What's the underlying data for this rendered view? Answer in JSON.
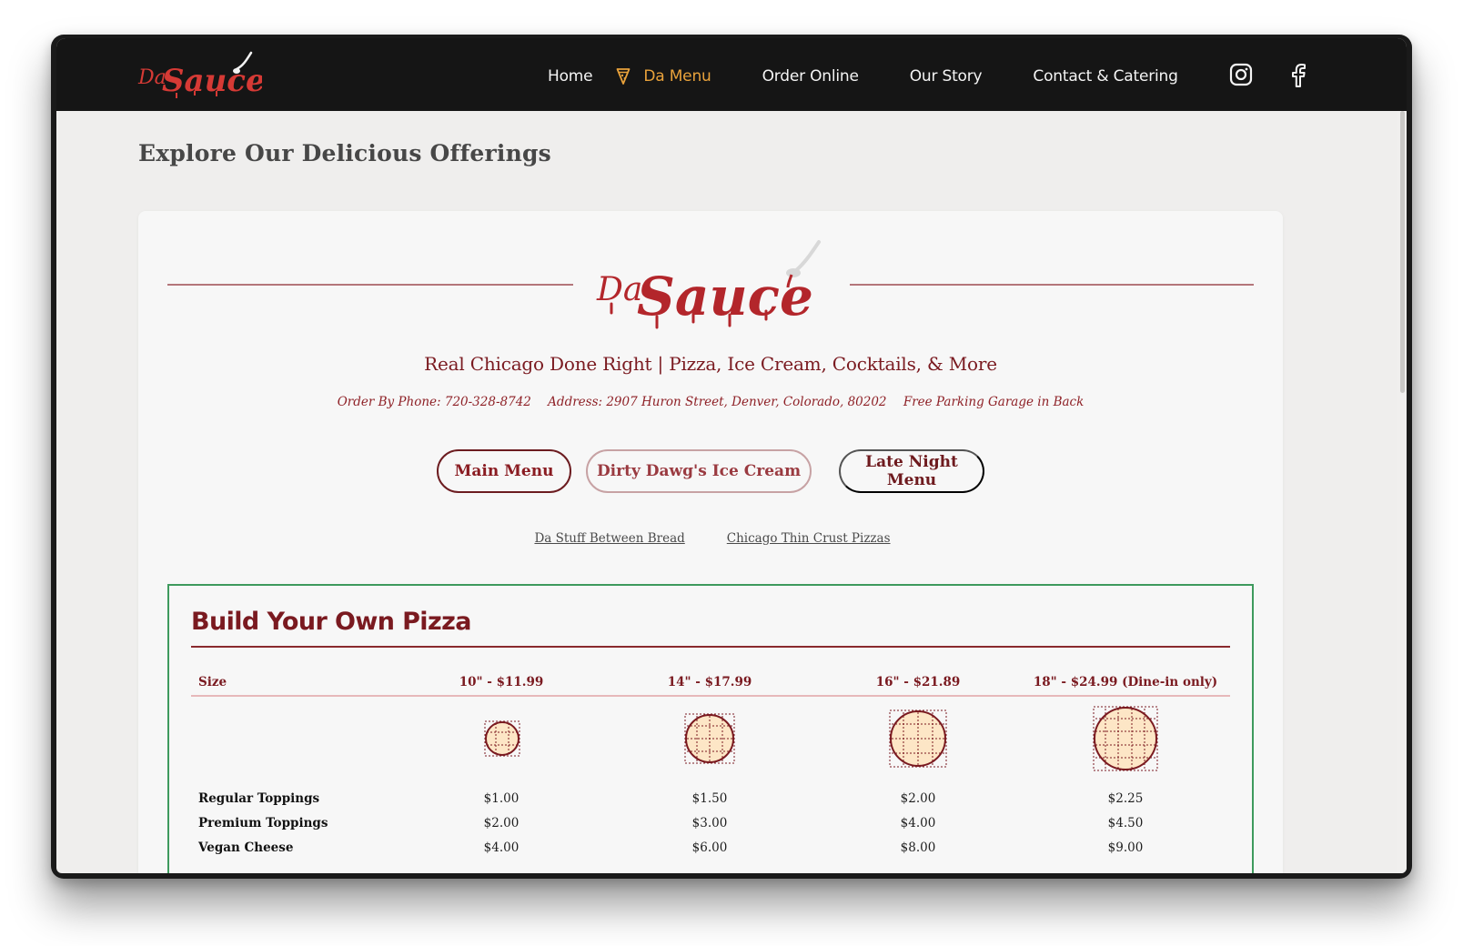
{
  "nav": {
    "brand": "Da Sauce",
    "links": [
      {
        "label": "Home",
        "active": false
      },
      {
        "label": "Da Menu",
        "active": true,
        "icon": "pizza-slice-icon"
      },
      {
        "label": "Order Online",
        "active": false
      },
      {
        "label": "Our Story",
        "active": false
      },
      {
        "label": "Contact & Catering",
        "active": false
      }
    ],
    "social": [
      {
        "name": "instagram",
        "icon": "instagram-icon"
      },
      {
        "name": "facebook",
        "icon": "facebook-icon"
      }
    ],
    "active_color": "#e9a23b"
  },
  "page": {
    "title": "Explore Our Delicious Offerings"
  },
  "menu_card": {
    "logo_text": "Da Sauce",
    "tagline": "Real Chicago Done Right | Pizza, Ice Cream, Cocktails, & More",
    "info": {
      "phone": "Order By Phone: 720-328-8742",
      "address": "Address: 2907 Huron Street, Denver, Colorado, 80202",
      "parking": "Free Parking Garage in Back"
    },
    "tabs": [
      {
        "label": "Main Menu",
        "selected": true
      },
      {
        "label": "Dirty Dawg's Ice Cream",
        "selected": false
      },
      {
        "label": "Late Night Menu",
        "selected": false
      }
    ],
    "sublinks": [
      "Da Stuff Between Bread",
      "Chicago Thin Crust Pizzas"
    ],
    "brand_color": "#7a1a20"
  },
  "build_your_own": {
    "title": "Build Your Own Pizza",
    "size_header": "Size",
    "sizes": [
      "10\" - $11.99",
      "14\" - $17.99",
      "16\" - $21.89",
      "18\" - $24.99 (Dine-in only)"
    ],
    "rows": [
      {
        "label": "Regular Toppings",
        "prices": [
          "$1.00",
          "$1.50",
          "$2.00",
          "$2.25"
        ]
      },
      {
        "label": "Premium Toppings",
        "prices": [
          "$2.00",
          "$3.00",
          "$4.00",
          "$4.50"
        ]
      },
      {
        "label": "Vegan Cheese",
        "prices": [
          "$4.00",
          "$6.00",
          "$8.00",
          "$9.00"
        ]
      }
    ]
  }
}
